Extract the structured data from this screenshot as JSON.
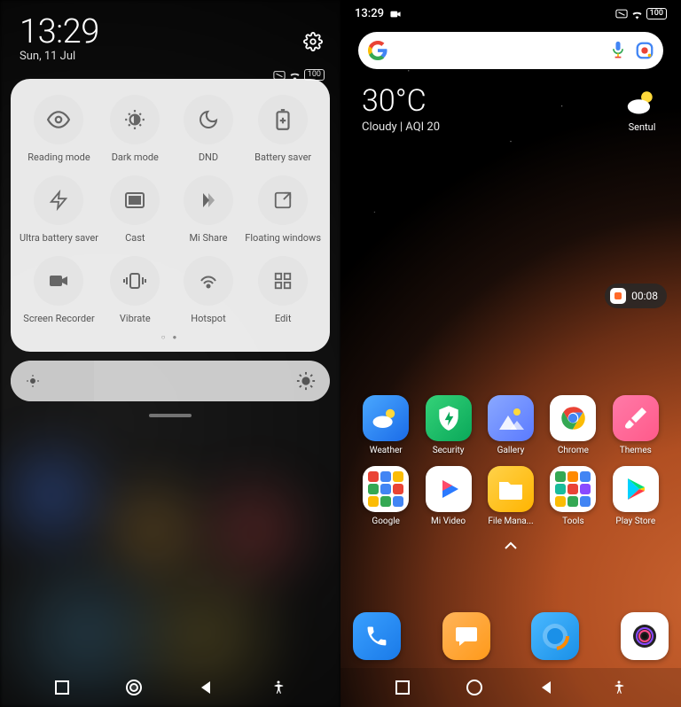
{
  "left": {
    "time": "13:29",
    "date": "Sun, 11 Jul",
    "battery": "100",
    "tiles": [
      {
        "id": "reading-mode",
        "label": "Reading mode"
      },
      {
        "id": "dark-mode",
        "label": "Dark mode"
      },
      {
        "id": "dnd",
        "label": "DND"
      },
      {
        "id": "battery-saver",
        "label": "Battery saver"
      },
      {
        "id": "ultra-battery",
        "label": "Ultra battery saver"
      },
      {
        "id": "cast",
        "label": "Cast"
      },
      {
        "id": "mi-share",
        "label": "Mi Share"
      },
      {
        "id": "floating-windows",
        "label": "Floating windows"
      },
      {
        "id": "screen-recorder",
        "label": "Screen Recorder"
      },
      {
        "id": "vibrate",
        "label": "Vibrate"
      },
      {
        "id": "hotspot",
        "label": "Hotspot"
      },
      {
        "id": "edit",
        "label": "Edit"
      }
    ],
    "page_dots": "○ ●"
  },
  "right": {
    "time": "13:29",
    "battery": "100",
    "temp": "30°C",
    "conditions": "Cloudy | AQI 20",
    "location": "Sentul",
    "rec_time": "00:08",
    "apps_row1": [
      {
        "id": "weather",
        "label": "Weather"
      },
      {
        "id": "security",
        "label": "Security"
      },
      {
        "id": "gallery",
        "label": "Gallery"
      },
      {
        "id": "chrome",
        "label": "Chrome"
      },
      {
        "id": "themes",
        "label": "Themes"
      }
    ],
    "apps_row2": [
      {
        "id": "google",
        "label": "Google"
      },
      {
        "id": "mivideo",
        "label": "Mi Video"
      },
      {
        "id": "fileman",
        "label": "File Mana..."
      },
      {
        "id": "tools",
        "label": "Tools"
      },
      {
        "id": "playstore",
        "label": "Play Store"
      }
    ],
    "dock": [
      {
        "id": "phone"
      },
      {
        "id": "messages"
      },
      {
        "id": "browser"
      },
      {
        "id": "camera"
      }
    ]
  }
}
